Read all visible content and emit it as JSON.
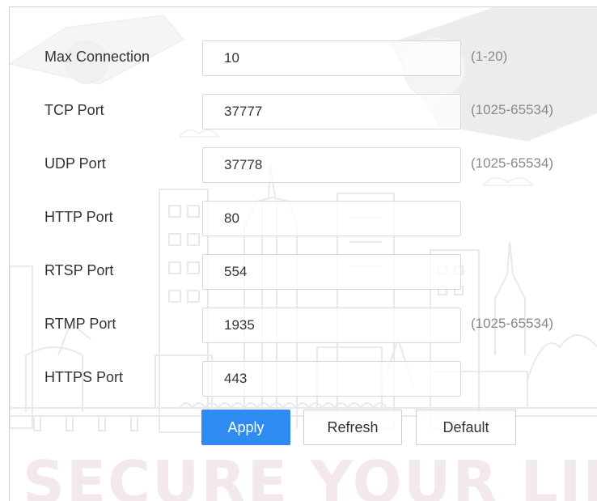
{
  "form": {
    "max_connection": {
      "label": "Max Connection",
      "value": "10",
      "hint": "(1-20)"
    },
    "tcp_port": {
      "label": "TCP Port",
      "value": "37777",
      "hint": "(1025-65534)"
    },
    "udp_port": {
      "label": "UDP Port",
      "value": "37778",
      "hint": "(1025-65534)"
    },
    "http_port": {
      "label": "HTTP Port",
      "value": "80"
    },
    "rtsp_port": {
      "label": "RTSP Port",
      "value": "554"
    },
    "rtmp_port": {
      "label": "RTMP Port",
      "value": "1935",
      "hint": "(1025-65534)"
    },
    "https_port": {
      "label": "HTTPS Port",
      "value": "443"
    }
  },
  "buttons": {
    "apply": "Apply",
    "refresh": "Refresh",
    "default": "Default"
  },
  "watermark": {
    "text": "SECURE YOUR LIFE"
  },
  "colors": {
    "accent": "#2f8bf2",
    "label_text": "#333333",
    "hint_text": "#8a8a8a",
    "border": "#d8d8d8"
  }
}
